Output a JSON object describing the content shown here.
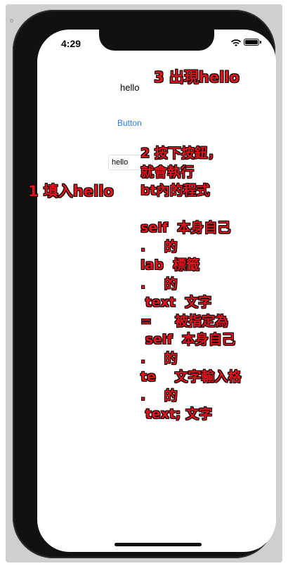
{
  "backdrop": {
    "label": "o"
  },
  "status_bar": {
    "time": "4:29"
  },
  "app": {
    "label_text": "hello",
    "button_label": "Button",
    "text_field_value": "hello"
  },
  "annotations": {
    "step1": "1 填入hello",
    "step3": "3 出現hello",
    "step2": "2 按下按鈕，\n就會執行\nbt內的程式\n\nself  本身自己\n.    的\nlab  標籤\n.    的\n text  文字\n=     被指定為\n self  本身自己\n.    的\nte    文字輸入格\n.    的\n text; 文字"
  }
}
